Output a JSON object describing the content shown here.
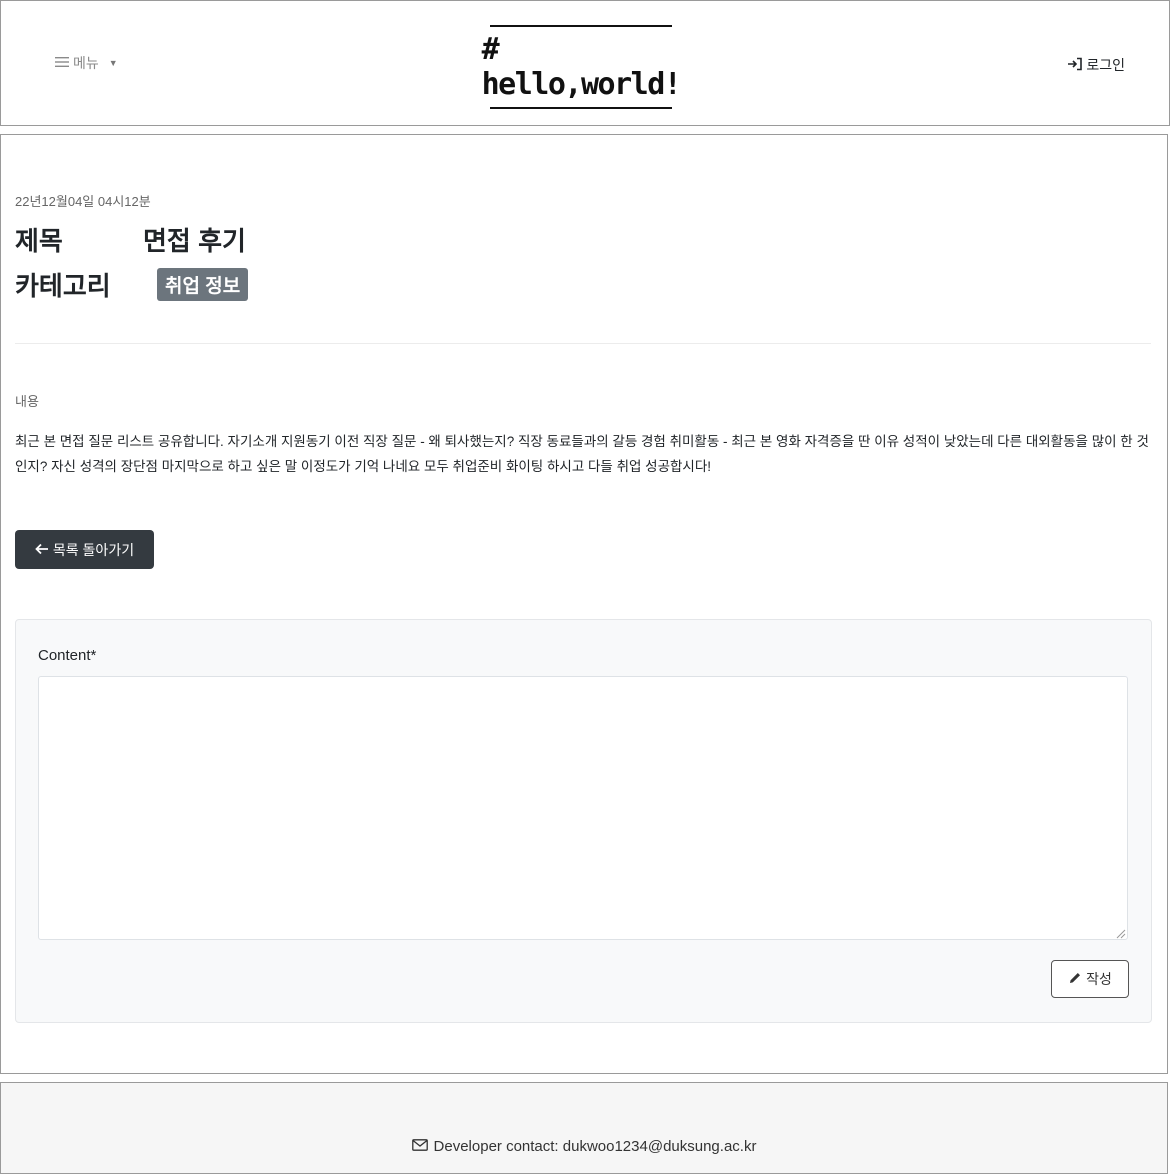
{
  "header": {
    "menu_label": "메뉴",
    "logo_text": "# hello,world!",
    "login_label": "로그인"
  },
  "post": {
    "date": "22년12월04일 04시12분",
    "title_label": "제목",
    "title": "면접 후기",
    "category_label": "카테고리",
    "category": "취업 정보",
    "content_label": "내용",
    "content": "최근 본 면접 질문 리스트 공유합니다. 자기소개 지원동기 이전 직장 질문 - 왜 퇴사했는지? 직장 동료들과의 갈등 경험 취미활동 - 최근 본 영화 자격증을 딴 이유 성적이 낮았는데 다른 대외활동을 많이 한 것인지? 자신 성격의 장단점 마지막으로 하고 싶은 말 이정도가 기억 나네요 모두 취업준비 화이팅 하시고 다들 취업 성공합시다!",
    "back_label": "목록 돌아가기"
  },
  "comment": {
    "label": "Content*",
    "value": "",
    "submit_label": "작성"
  },
  "footer": {
    "contact": "Developer contact: dukwoo1234@duksung.ac.kr"
  },
  "icons": {
    "menu": "hamburger-icon",
    "caret": "caret-down-icon",
    "login": "box-arrow-in-right-icon",
    "back": "arrow-left-icon",
    "write": "pencil-icon",
    "mail": "envelope-icon"
  },
  "colors": {
    "badge_bg": "#6c757d",
    "back_button_bg": "#343a40",
    "card_bg": "#f8f9fa"
  }
}
